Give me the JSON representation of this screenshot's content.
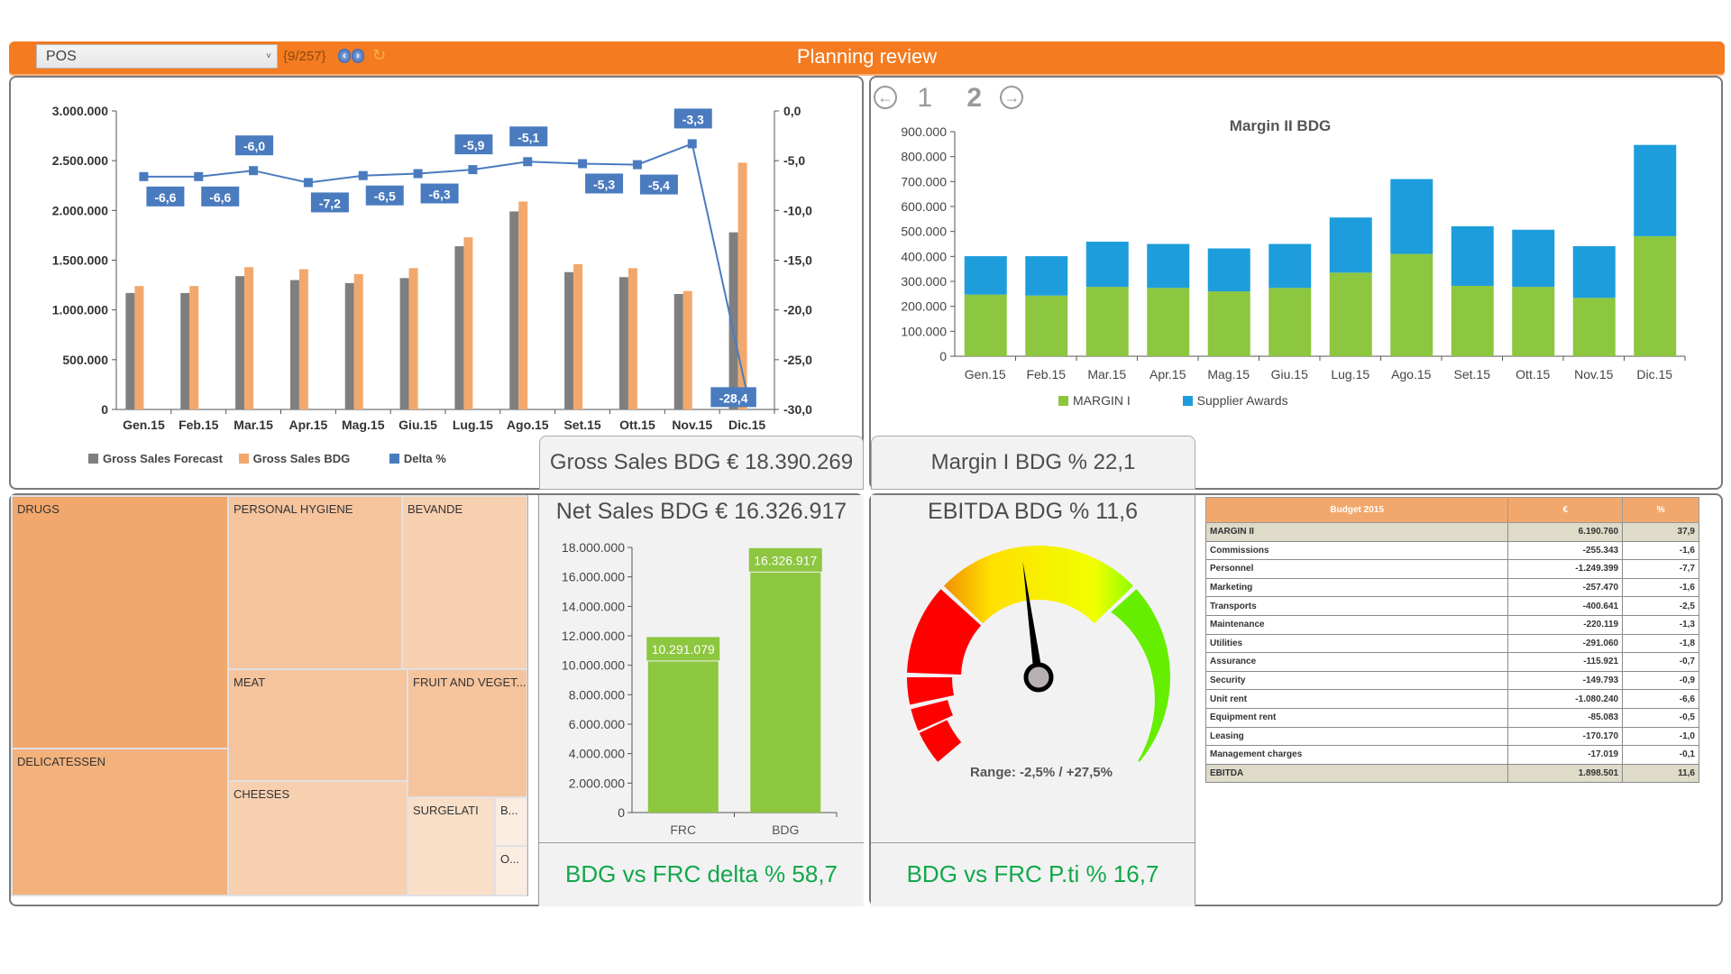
{
  "header": {
    "selector_value": "POS",
    "record_counter": "{9/257}",
    "prev_icon": "chevron-left",
    "next_icon": "chevron-right",
    "refresh_icon": "refresh",
    "title": "Planning review"
  },
  "colors": {
    "header": "#f47b20",
    "forecast": "#7f7f7f",
    "budget": "#f2a86c",
    "delta": "#4a7bbf",
    "margin1": "#8dc63f",
    "supplier": "#1e9ddc",
    "kpi_green": "#12a84a"
  },
  "gross_sales": {
    "kpi": "Gross Sales BDG € 18.390.269",
    "chart_data": {
      "type": "bar+line",
      "categories": [
        "Gen.15",
        "Feb.15",
        "Mar.15",
        "Apr.15",
        "Mag.15",
        "Giu.15",
        "Lug.15",
        "Ago.15",
        "Set.15",
        "Ott.15",
        "Nov.15",
        "Dic.15"
      ],
      "series": [
        {
          "name": "Gross Sales Forecast",
          "type": "bar",
          "axis": "left",
          "values": [
            1170000,
            1170000,
            1340000,
            1300000,
            1270000,
            1320000,
            1640000,
            1990000,
            1380000,
            1330000,
            1160000,
            1780000
          ]
        },
        {
          "name": "Gross Sales BDG",
          "type": "bar",
          "axis": "left",
          "values": [
            1240000,
            1240000,
            1430000,
            1410000,
            1360000,
            1420000,
            1730000,
            2090000,
            1460000,
            1420000,
            1190000,
            2480000
          ]
        },
        {
          "name": "Delta %",
          "type": "line",
          "axis": "right",
          "values": [
            -6.6,
            -6.6,
            -6.0,
            -7.2,
            -6.5,
            -6.3,
            -5.9,
            -5.1,
            -5.3,
            -5.4,
            -3.3,
            -28.4
          ],
          "labels": [
            "-6,6",
            "-6,6",
            "-6,0",
            "-7,2",
            "-6,5",
            "-6,3",
            "-5,9",
            "-5,1",
            "-5,3",
            "-5,4",
            "-3,3",
            "-28,4"
          ]
        }
      ],
      "left_axis": {
        "min": 0,
        "max": 3000000,
        "ticks": [
          "0",
          "500.000",
          "1.000.000",
          "1.500.000",
          "2.000.000",
          "2.500.000",
          "3.000.000"
        ]
      },
      "right_axis": {
        "min": -30,
        "max": 0,
        "ticks": [
          "0,0",
          "-5,0",
          "-10,0",
          "-15,0",
          "-20,0",
          "-25,0",
          "-30,0"
        ]
      },
      "legend": [
        "Gross Sales Forecast",
        "Gross Sales BDG",
        "Delta %"
      ],
      "legend_position": "bottom-left"
    }
  },
  "margin2": {
    "pager": {
      "prev_icon": "arrow-left-circle",
      "page1": "1",
      "page2": "2",
      "next_icon": "arrow-right-circle",
      "current": 2
    },
    "kpi": "Margin I BDG % 22,1",
    "chart_data": {
      "type": "stacked-bar",
      "title": "Margin II BDG",
      "categories": [
        "Gen.15",
        "Feb.15",
        "Mar.15",
        "Apr.15",
        "Mag.15",
        "Giu.15",
        "Lug.15",
        "Ago.15",
        "Set.15",
        "Ott.15",
        "Nov.15",
        "Dic.15"
      ],
      "series": [
        {
          "name": "MARGIN I",
          "values": [
            247000,
            243000,
            278000,
            274000,
            260000,
            274000,
            335000,
            410000,
            282000,
            278000,
            234000,
            481000
          ]
        },
        {
          "name": "Supplier Awards",
          "values": [
            154000,
            158000,
            181000,
            176000,
            172000,
            176000,
            221000,
            300000,
            239000,
            229000,
            207000,
            366000
          ]
        }
      ],
      "y_axis": {
        "min": 0,
        "max": 900000,
        "ticks": [
          "0",
          "100.000",
          "200.000",
          "300.000",
          "400.000",
          "500.000",
          "600.000",
          "700.000",
          "800.000",
          "900.000"
        ]
      },
      "legend": [
        "MARGIN I",
        "Supplier Awards"
      ],
      "legend_position": "bottom"
    }
  },
  "treemap": {
    "items": [
      {
        "label": "DRUGS",
        "shade": 0
      },
      {
        "label": "DELICATESSEN",
        "shade": 1
      },
      {
        "label": "PERSONAL HYGIENE",
        "shade": 2
      },
      {
        "label": "BEVANDE",
        "shade": 3
      },
      {
        "label": "MEAT",
        "shade": 2
      },
      {
        "label": "FRUIT AND VEGET...",
        "shade": 2
      },
      {
        "label": "CHEESES",
        "shade": 3
      },
      {
        "label": "SURGELATI",
        "shade": 4
      },
      {
        "label": "B...",
        "shade": 5
      },
      {
        "label": "O...",
        "shade": 5
      }
    ]
  },
  "net_sales": {
    "title": "Net Sales BDG € 16.326.917",
    "footer": "BDG vs FRC delta % 58,7",
    "chart_data": {
      "type": "bar",
      "categories": [
        "FRC",
        "BDG"
      ],
      "values": [
        10291079,
        16326917
      ],
      "labels": [
        "10.291.079",
        "16.326.917"
      ],
      "y_axis": {
        "min": 0,
        "max": 18000000,
        "ticks": [
          "0",
          "2.000.000",
          "4.000.000",
          "6.000.000",
          "8.000.000",
          "10.000.000",
          "12.000.000",
          "14.000.000",
          "16.000.000",
          "18.000.000"
        ]
      }
    }
  },
  "ebitda": {
    "title": "EBITDA BDG % 11,6",
    "footer": "BDG vs FRC P.ti % 16,7",
    "gauge": {
      "value": 11.6,
      "min": -2.5,
      "max": 27.5,
      "range_label": "Range: -2,5% / +27,5%"
    }
  },
  "budget_table": {
    "headers": [
      "Budget 2015",
      "€",
      "%"
    ],
    "rows": [
      {
        "label": "MARGIN II",
        "eur": "6.190.760",
        "pct": "37,9",
        "highlight": true
      },
      {
        "label": "Commissions",
        "eur": "-255.343",
        "pct": "-1,6"
      },
      {
        "label": "Personnel",
        "eur": "-1.249.399",
        "pct": "-7,7"
      },
      {
        "label": "Marketing",
        "eur": "-257.470",
        "pct": "-1,6"
      },
      {
        "label": "Transports",
        "eur": "-400.641",
        "pct": "-2,5"
      },
      {
        "label": "Maintenance",
        "eur": "-220.119",
        "pct": "-1,3"
      },
      {
        "label": "Utilities",
        "eur": "-291.060",
        "pct": "-1,8"
      },
      {
        "label": "Assurance",
        "eur": "-115.921",
        "pct": "-0,7"
      },
      {
        "label": "Security",
        "eur": "-149.793",
        "pct": "-0,9"
      },
      {
        "label": "Unit rent",
        "eur": "-1.080.240",
        "pct": "-6,6"
      },
      {
        "label": "Equipment rent",
        "eur": "-85.083",
        "pct": "-0,5"
      },
      {
        "label": "Leasing",
        "eur": "-170.170",
        "pct": "-1,0"
      },
      {
        "label": "Management charges",
        "eur": "-17.019",
        "pct": "-0,1"
      },
      {
        "label": "EBITDA",
        "eur": "1.898.501",
        "pct": "11,6",
        "highlight": true
      }
    ]
  }
}
